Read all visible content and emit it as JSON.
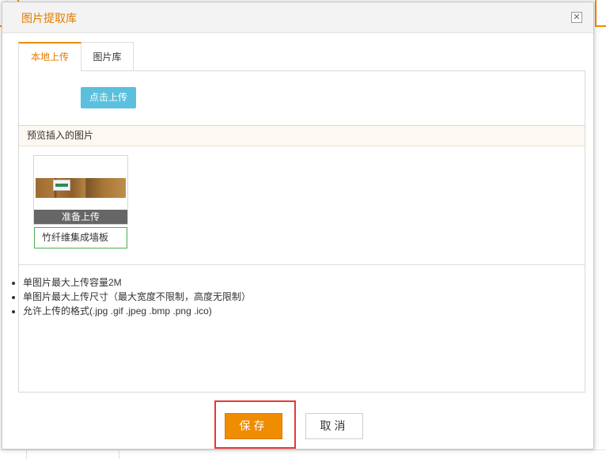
{
  "dialog": {
    "title": "图片提取库",
    "close_icon": "close-icon"
  },
  "tabs": [
    {
      "label": "本地上传",
      "active": true
    },
    {
      "label": "图片库",
      "active": false
    }
  ],
  "upload": {
    "button_label": "点击上传"
  },
  "preview": {
    "header": "预览插入的图片",
    "items": [
      {
        "status": "准备上传",
        "name": "竹纤维集成墙板"
      }
    ]
  },
  "notes": [
    "单图片最大上传容量2M",
    "单图片最大上传尺寸（最大宽度不限制，高度无限制）",
    "允许上传的格式(.jpg .gif .jpeg .bmp .png .ico)"
  ],
  "footer": {
    "save_label": "保存",
    "cancel_label": "取消"
  },
  "colors": {
    "accent": "#f08c00",
    "upload_button": "#5bc0de",
    "highlight": "#e53935"
  }
}
